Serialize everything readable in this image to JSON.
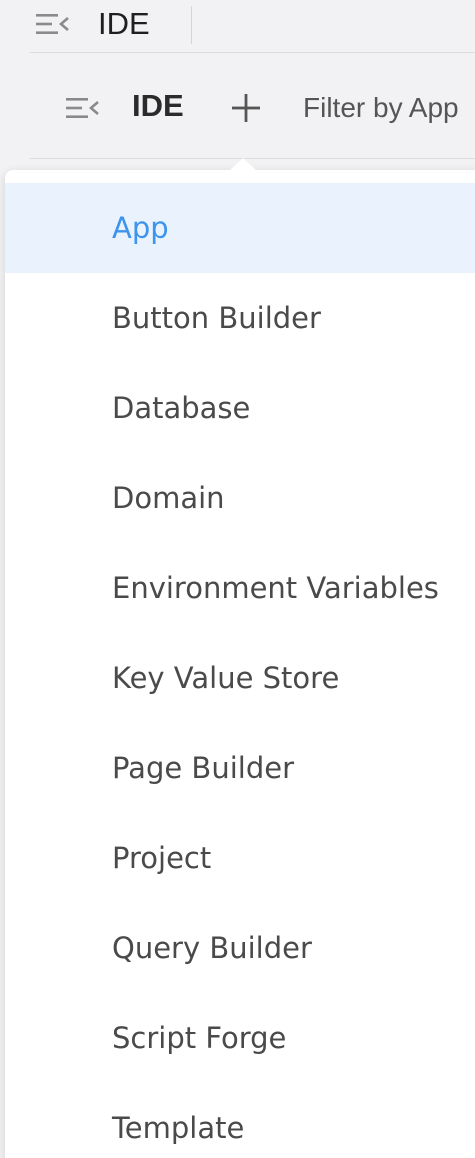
{
  "header": {
    "title": "IDE"
  },
  "toolbar": {
    "title": "IDE",
    "filter_label": "Filter by App"
  },
  "dropdown": {
    "selected": "App",
    "options": [
      "App",
      "Button Builder",
      "Database",
      "Domain",
      "Environment Variables",
      "Key Value Store",
      "Page Builder",
      "Project",
      "Query Builder",
      "Script Forge",
      "Template"
    ]
  },
  "colors": {
    "accent": "#3d94ee",
    "selected_bg": "#e9f2fd",
    "page_bg": "#f2f2f4",
    "text": "#4a4a4a"
  },
  "icons": {
    "menu": "menu-collapse-icon",
    "add": "plus-icon"
  }
}
